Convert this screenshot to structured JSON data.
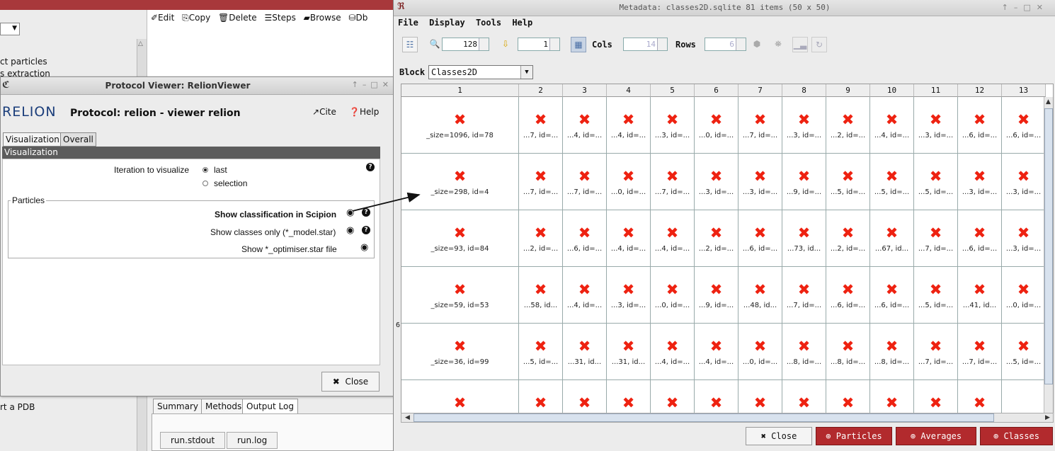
{
  "background": {
    "tree_items": [
      "ct particles",
      "s extraction",
      "rt a PDB"
    ],
    "toolbar": {
      "edit": "✐Edit",
      "copy": "⎘Copy",
      "delete": "🗑Delete",
      "steps": "☰Steps",
      "browse": "▰Browse",
      "db": "⛁Db"
    },
    "tabs": [
      "Summary",
      "Methods",
      "Output Log"
    ],
    "subtabs": [
      "run.stdout",
      "run.log"
    ]
  },
  "protocol_viewer": {
    "window_title": "Protocol Viewer: RelionViewer",
    "logo_text": "RELION",
    "protocol_title": "Protocol: relion - viewer relion",
    "cite": "Cite",
    "help": "Help",
    "tabs": [
      "Visualization",
      "Overall"
    ],
    "section": "Visualization",
    "iteration_label": "Iteration to visualize",
    "option_last": "last",
    "option_selection": "selection",
    "group_label": "Particles",
    "show_classification": "Show classification in Scipion",
    "show_classes": "Show classes only (*_model.star)",
    "show_optimiser": "Show *_optimiser.star file",
    "close": "Close"
  },
  "metadata_window": {
    "title": "Metadata: classes2D.sqlite 81 items (50 x 50)",
    "menu": [
      "File",
      "Display",
      "Tools",
      "Help"
    ],
    "zoom_value": "128",
    "index_value": "1",
    "cols_label": "Cols",
    "cols_value": "14",
    "rows_label": "Rows",
    "rows_value": "6",
    "block_label": "Block",
    "block_value": "Classes2D",
    "column_headers": [
      "1",
      "2",
      "3",
      "4",
      "5",
      "6",
      "7",
      "8",
      "9",
      "10",
      "11",
      "12",
      "13"
    ],
    "rows": [
      [
        "_size=1096, id=78",
        "...7, id=...",
        "...4, id=...",
        "...4, id=...",
        "...3, id=...",
        "...0, id=...",
        "...7, id=...",
        "...3, id=...",
        "...2, id=...",
        "...4, id=...",
        "...3, id=...",
        "...6, id=...",
        "...6, id=..."
      ],
      [
        "_size=298, id=4",
        "...7, id=...",
        "...7, id=...",
        "...0, id=...",
        "...7, id=...",
        "...3, id=...",
        "...3, id=...",
        "...9, id=...",
        "...5, id=...",
        "...5, id=...",
        "...5, id=...",
        "...3, id=...",
        "...3, id=..."
      ],
      [
        "_size=93, id=84",
        "...2, id=...",
        "...6, id=...",
        "...4, id=...",
        "...4, id=...",
        "...2, id=...",
        "...6, id=...",
        "...73, id...",
        "...2, id=...",
        "...67, id...",
        "...7, id=...",
        "...6, id=...",
        "...3, id=..."
      ],
      [
        "_size=59, id=53",
        "...58, id...",
        "...4, id=...",
        "...3, id=...",
        "...0, id=...",
        "...9, id=...",
        "...48, id...",
        "...7, id=...",
        "...6, id=...",
        "...6, id=...",
        "...5, id=...",
        "...41, id...",
        "...0, id=..."
      ],
      [
        "_size=36, id=99",
        "...5, id=...",
        "...31, id...",
        "...31, id...",
        "...4, id=...",
        "...4, id=...",
        "...0, id=...",
        "...8, id=...",
        "...8, id=...",
        "...8, id=...",
        "...7, id=...",
        "...7, id=...",
        "...5, id=..."
      ],
      [
        "",
        "",
        "",
        "",
        "",
        "",
        "",
        "",
        "",
        "",
        "",
        "",
        ""
      ]
    ],
    "last_row_count": 12,
    "row_label": "6",
    "buttons": {
      "close": "Close",
      "particles": "Particles",
      "averages": "Averages",
      "classes": "Classes"
    }
  }
}
